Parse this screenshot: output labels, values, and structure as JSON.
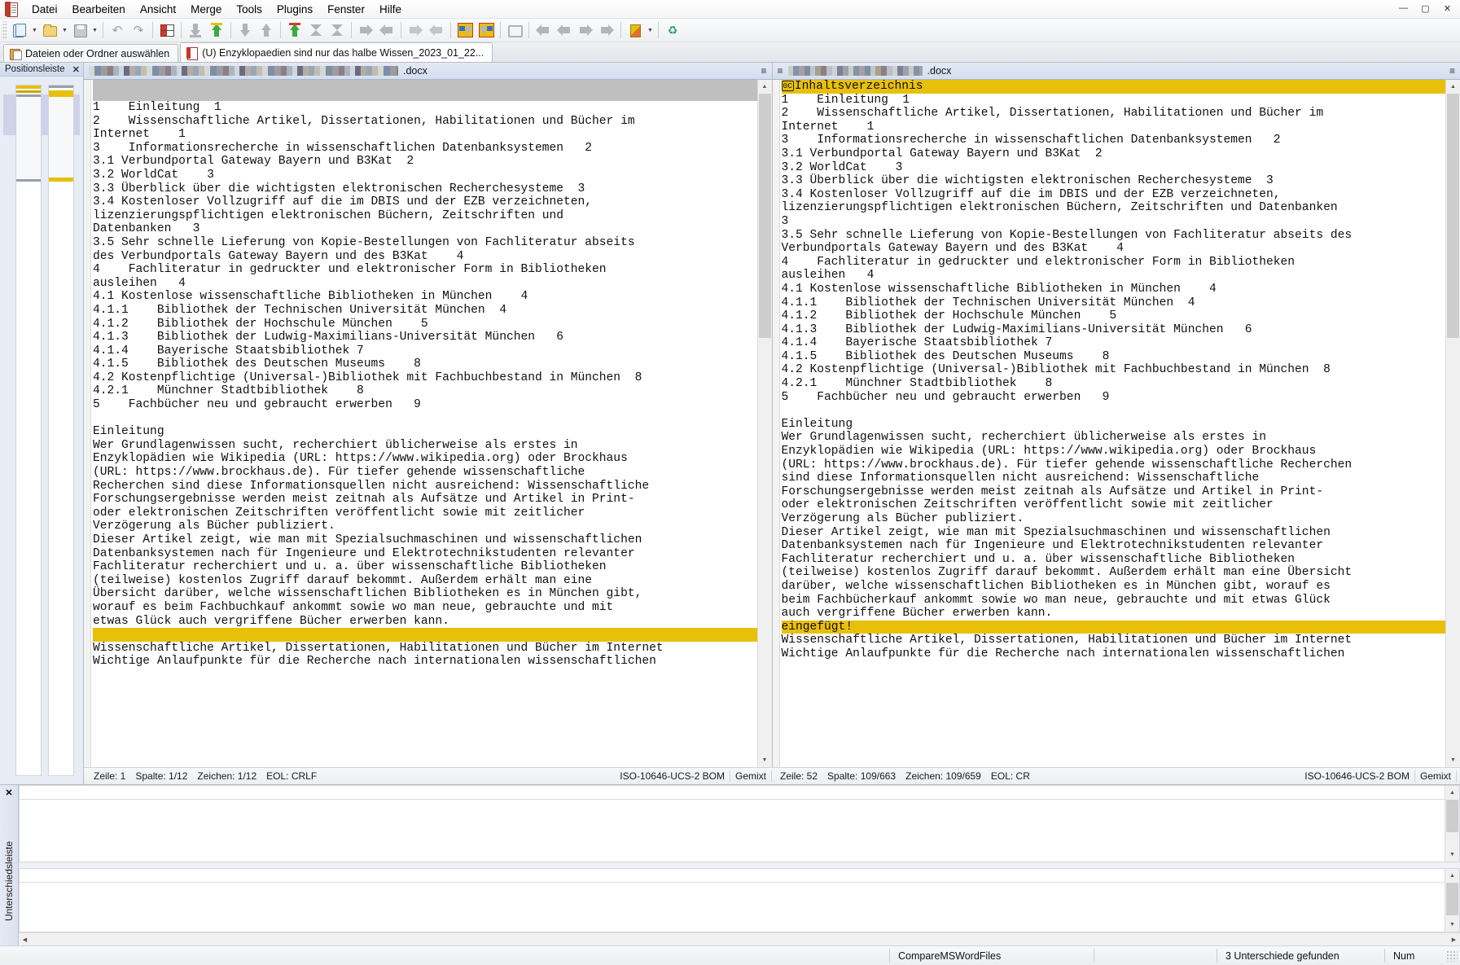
{
  "window": {
    "app_icon": "compare-docs-icon",
    "controls": {
      "minimize": "—",
      "maximize": "▢",
      "close": "✕"
    }
  },
  "menu": {
    "items": [
      {
        "label": "Datei",
        "name": "menu-datei"
      },
      {
        "label": "Bearbeiten",
        "name": "menu-bearbeiten"
      },
      {
        "label": "Ansicht",
        "name": "menu-ansicht"
      },
      {
        "label": "Merge",
        "name": "menu-merge"
      },
      {
        "label": "Tools",
        "name": "menu-tools"
      },
      {
        "label": "Plugins",
        "name": "menu-plugins"
      },
      {
        "label": "Fenster",
        "name": "menu-fenster"
      },
      {
        "label": "Hilfe",
        "name": "menu-hilfe"
      }
    ]
  },
  "toolbar": {
    "buttons": [
      "new-compare-icon",
      "open-folder-icon",
      "save-icon",
      "undo-icon",
      "redo-icon",
      "diff-blocks-icon",
      "copy-right-down-icon",
      "copy-left-up-icon",
      "copy-to-right-icon",
      "copy-to-left-icon",
      "copy-all-up-icon",
      "next-diff-collapse-icon",
      "prev-diff-collapse-icon",
      "move-right-icon",
      "move-left-icon",
      "copy-right-advance-icon",
      "copy-left-advance-icon",
      "next-difference-icon",
      "previous-difference-icon",
      "first-difference-icon",
      "prev-file-icon",
      "prev-conflict-icon",
      "next-conflict-icon",
      "next-file-icon",
      "highlight-icon",
      "refresh-icon"
    ]
  },
  "tabs": [
    {
      "label": "Dateien oder Ordner auswählen",
      "icon": "select-files-icon",
      "active": false
    },
    {
      "label": "(U) Enzyklopaedien sind nur das halbe Wissen_2023_01_22...",
      "icon": "document-compare-icon",
      "active": true
    }
  ],
  "location_pane": {
    "title": "Positionsleiste",
    "close_label": "✕"
  },
  "left_pane": {
    "file_suffix": ".docx",
    "menu_glyph": "≡",
    "status": {
      "line": "Zeile: 1",
      "column": "Spalte: 1/12",
      "chars": "Zeichen: 1/12",
      "eol": "EOL: CRLF",
      "encoding": "ISO-10646-UCS-2 BOM",
      "mode": "Gemixt"
    },
    "lines": [
      {
        "text": "",
        "style": "grey"
      },
      {
        "text": "1    Einleitung  1",
        "style": "normal"
      },
      {
        "text": "2    Wissenschaftliche Artikel, Dissertationen, Habilitationen und Bücher im",
        "style": "normal"
      },
      {
        "text": "Internet    1",
        "style": "normal"
      },
      {
        "text": "3    Informationsrecherche in wissenschaftlichen Datenbanksystemen   2",
        "style": "normal"
      },
      {
        "text": "3.1 Verbundportal Gateway Bayern und B3Kat  2",
        "style": "normal"
      },
      {
        "text": "3.2 WorldCat    3",
        "style": "normal"
      },
      {
        "text": "3.3 Überblick über die wichtigsten elektronischen Recherchesysteme  3",
        "style": "normal"
      },
      {
        "text": "3.4 Kostenloser Vollzugriff auf die im DBIS und der EZB verzeichneten,",
        "style": "normal"
      },
      {
        "text": "lizenzierungspflichtigen elektronischen Büchern, Zeitschriften und",
        "style": "normal"
      },
      {
        "text": "Datenbanken   3",
        "style": "normal"
      },
      {
        "text": "3.5 Sehr schnelle Lieferung von Kopie-Bestellungen von Fachliteratur abseits",
        "style": "normal"
      },
      {
        "text": "des Verbundportals Gateway Bayern und des B3Kat    4",
        "style": "normal"
      },
      {
        "text": "4    Fachliteratur in gedruckter und elektronischer Form in Bibliotheken",
        "style": "normal"
      },
      {
        "text": "ausleihen   4",
        "style": "normal"
      },
      {
        "text": "4.1 Kostenlose wissenschaftliche Bibliotheken in München    4",
        "style": "normal"
      },
      {
        "text": "4.1.1    Bibliothek der Technischen Universität München  4",
        "style": "normal"
      },
      {
        "text": "4.1.2    Bibliothek der Hochschule München    5",
        "style": "normal"
      },
      {
        "text": "4.1.3    Bibliothek der Ludwig-Maximilians-Universität München   6",
        "style": "normal"
      },
      {
        "text": "4.1.4    Bayerische Staatsbibliothek 7",
        "style": "normal"
      },
      {
        "text": "4.1.5    Bibliothek des Deutschen Museums    8",
        "style": "normal"
      },
      {
        "text": "4.2 Kostenpflichtige (Universal-)Bibliothek mit Fachbuchbestand in München  8",
        "style": "normal"
      },
      {
        "text": "4.2.1    Münchner Stadtbibliothek    8",
        "style": "normal"
      },
      {
        "text": "5    Fachbücher neu und gebraucht erwerben   9",
        "style": "normal"
      },
      {
        "text": "",
        "style": "normal"
      },
      {
        "text": "Einleitung",
        "style": "normal"
      },
      {
        "text": "Wer Grundlagenwissen sucht, recherchiert üblicherweise als erstes in",
        "style": "normal"
      },
      {
        "text": "Enzyklopädien wie Wikipedia (URL: https://www.wikipedia.org) oder Brockhaus",
        "style": "normal"
      },
      {
        "text": "(URL: https://www.brockhaus.de). Für tiefer gehende wissenschaftliche",
        "style": "normal"
      },
      {
        "text": "Recherchen sind diese Informationsquellen nicht ausreichend: Wissenschaftliche",
        "style": "normal"
      },
      {
        "text": "Forschungsergebnisse werden meist zeitnah als Aufsätze und Artikel in Print-",
        "style": "normal"
      },
      {
        "text": "oder elektronischen Zeitschriften veröffentlicht sowie mit zeitlicher",
        "style": "normal"
      },
      {
        "text": "Verzögerung als Bücher publiziert.",
        "style": "normal"
      },
      {
        "text": "Dieser Artikel zeigt, wie man mit Spezialsuchmaschinen und wissenschaftlichen",
        "style": "normal"
      },
      {
        "text": "Datenbanksystemen nach für Ingenieure und Elektrotechnikstudenten relevanter",
        "style": "normal"
      },
      {
        "text": "Fachliteratur recherchiert und u. a. über wissenschaftliche Bibliotheken",
        "style": "normal"
      },
      {
        "text": "(teilweise) kostenlos Zugriff darauf bekommt. Außerdem erhält man eine",
        "style": "normal"
      },
      {
        "text": "Übersicht darüber, welche wissenschaftlichen Bibliotheken es in München gibt,",
        "style": "normal"
      },
      {
        "text": "worauf es beim Fachbuchkauf ankommt sowie wo man neue, gebrauchte und mit",
        "style": "normal"
      },
      {
        "text": "etwas Glück auch vergriffene Bücher erwerben kann.",
        "style": "normal"
      },
      {
        "text": "",
        "style": "gold-empty"
      },
      {
        "text": "Wissenschaftliche Artikel, Dissertationen, Habilitationen und Bücher im Internet",
        "style": "normal"
      },
      {
        "text": "Wichtige Anlaufpunkte für die Recherche nach internationalen wissenschaftlichen",
        "style": "normal"
      }
    ]
  },
  "right_pane": {
    "file_suffix": ".docx",
    "menu_glyph": "≡",
    "status": {
      "line": "Zeile: 52",
      "column": "Spalte: 109/663",
      "chars": "Zeichen: 109/659",
      "eol": "EOL: CR",
      "encoding": "ISO-10646-UCS-2 BOM",
      "mode": "Gemixt"
    },
    "lines": [
      {
        "text": "Inhaltsverzeichnis",
        "style": "gold",
        "control_char": "0C"
      },
      {
        "text": "1    Einleitung  1",
        "style": "normal"
      },
      {
        "text": "2    Wissenschaftliche Artikel, Dissertationen, Habilitationen und Bücher im",
        "style": "normal"
      },
      {
        "text": "Internet    1",
        "style": "normal"
      },
      {
        "text": "3    Informationsrecherche in wissenschaftlichen Datenbanksystemen   2",
        "style": "normal"
      },
      {
        "text": "3.1 Verbundportal Gateway Bayern und B3Kat  2",
        "style": "normal"
      },
      {
        "text": "3.2 WorldCat    3",
        "style": "normal"
      },
      {
        "text": "3.3 Überblick über die wichtigsten elektronischen Recherchesysteme  3",
        "style": "normal"
      },
      {
        "text": "3.4 Kostenloser Vollzugriff auf die im DBIS und der EZB verzeichneten,",
        "style": "normal"
      },
      {
        "text": "lizenzierungspflichtigen elektronischen Büchern, Zeitschriften und Datenbanken",
        "style": "normal"
      },
      {
        "text": "3",
        "style": "normal"
      },
      {
        "text": "3.5 Sehr schnelle Lieferung von Kopie-Bestellungen von Fachliteratur abseits des",
        "style": "normal"
      },
      {
        "text": "Verbundportals Gateway Bayern und des B3Kat    4",
        "style": "normal"
      },
      {
        "text": "4    Fachliteratur in gedruckter und elektronischer Form in Bibliotheken",
        "style": "normal"
      },
      {
        "text": "ausleihen   4",
        "style": "normal"
      },
      {
        "text": "4.1 Kostenlose wissenschaftliche Bibliotheken in München    4",
        "style": "normal"
      },
      {
        "text": "4.1.1    Bibliothek der Technischen Universität München  4",
        "style": "normal"
      },
      {
        "text": "4.1.2    Bibliothek der Hochschule München    5",
        "style": "normal"
      },
      {
        "text": "4.1.3    Bibliothek der Ludwig-Maximilians-Universität München   6",
        "style": "normal"
      },
      {
        "text": "4.1.4    Bayerische Staatsbibliothek 7",
        "style": "normal"
      },
      {
        "text": "4.1.5    Bibliothek des Deutschen Museums    8",
        "style": "normal"
      },
      {
        "text": "4.2 Kostenpflichtige (Universal-)Bibliothek mit Fachbuchbestand in München  8",
        "style": "normal"
      },
      {
        "text": "4.2.1    Münchner Stadtbibliothek    8",
        "style": "normal"
      },
      {
        "text": "5    Fachbücher neu und gebraucht erwerben   9",
        "style": "normal"
      },
      {
        "text": "",
        "style": "normal"
      },
      {
        "text": "Einleitung",
        "style": "normal"
      },
      {
        "text": "Wer Grundlagenwissen sucht, recherchiert üblicherweise als erstes in",
        "style": "normal"
      },
      {
        "text": "Enzyklopädien wie Wikipedia (URL: https://www.wikipedia.org) oder Brockhaus",
        "style": "normal"
      },
      {
        "text": "(URL: https://www.brockhaus.de). Für tiefer gehende wissenschaftliche Recherchen",
        "style": "normal"
      },
      {
        "text": "sind diese Informationsquellen nicht ausreichend: Wissenschaftliche",
        "style": "normal"
      },
      {
        "text": "Forschungsergebnisse werden meist zeitnah als Aufsätze und Artikel in Print-",
        "style": "normal"
      },
      {
        "text": "oder elektronischen Zeitschriften veröffentlicht sowie mit zeitlicher",
        "style": "normal"
      },
      {
        "text": "Verzögerung als Bücher publiziert.",
        "style": "normal"
      },
      {
        "text": "Dieser Artikel zeigt, wie man mit Spezialsuchmaschinen und wissenschaftlichen",
        "style": "normal"
      },
      {
        "text": "Datenbanksystemen nach für Ingenieure und Elektrotechnikstudenten relevanter",
        "style": "normal"
      },
      {
        "text": "Fachliteratur recherchiert und u. a. über wissenschaftliche Bibliotheken",
        "style": "normal"
      },
      {
        "text": "(teilweise) kostenlos Zugriff darauf bekommt. Außerdem erhält man eine Übersicht",
        "style": "normal"
      },
      {
        "text": "darüber, welche wissenschaftlichen Bibliotheken es in München gibt, worauf es",
        "style": "normal"
      },
      {
        "text": "beim Fachbücherkauf ankommt sowie wo man neue, gebrauchte und mit etwas Glück",
        "style": "normal"
      },
      {
        "text": "auch vergriffene Bücher erwerben kann.",
        "style": "normal"
      },
      {
        "text": "eingefügt!",
        "style": "gold"
      },
      {
        "text": "Wissenschaftliche Artikel, Dissertationen, Habilitationen und Bücher im Internet",
        "style": "normal"
      },
      {
        "text": "Wichtige Anlaufpunkte für die Recherche nach internationalen wissenschaftlichen",
        "style": "normal"
      }
    ]
  },
  "difference_pane": {
    "title": "Unterschiedsleiste",
    "close_label": "✕"
  },
  "app_status": {
    "plugin": "CompareMSWordFiles",
    "differences": "3 Unterschiede gefunden",
    "num_lock": "Num"
  },
  "colors": {
    "diff_highlight": "#e8c00a",
    "grey_block": "#bfbfbf",
    "pane_header": "#d3def0",
    "selection": "#7878be"
  }
}
